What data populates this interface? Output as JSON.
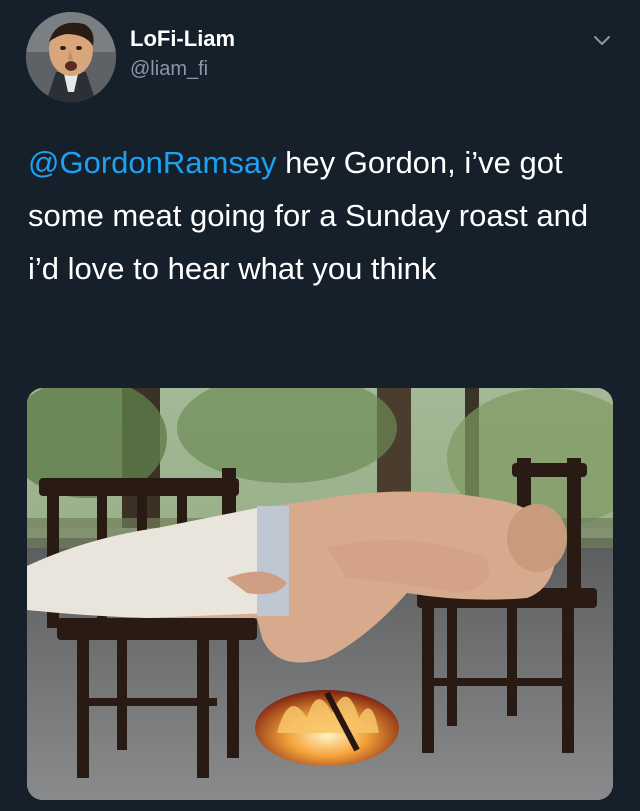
{
  "tweet": {
    "author": {
      "display_name": "LoFi-Liam",
      "handle": "@liam_fi",
      "avatar_icon": "cartoon-avatar-icon"
    },
    "menu_icon": "chevron-down-icon",
    "text": {
      "mention": "@GordonRamsay",
      "body": " hey Gordon, i’ve got some meat going for a Sunday roast and i’d love to hear what you think"
    },
    "media": {
      "kind": "photo",
      "icon": "photo-man-lying-across-two-chairs-over-fire"
    }
  },
  "colors": {
    "background": "#15202b",
    "text": "#ffffff",
    "secondary_text": "#8899a6",
    "link": "#1da1f2"
  }
}
